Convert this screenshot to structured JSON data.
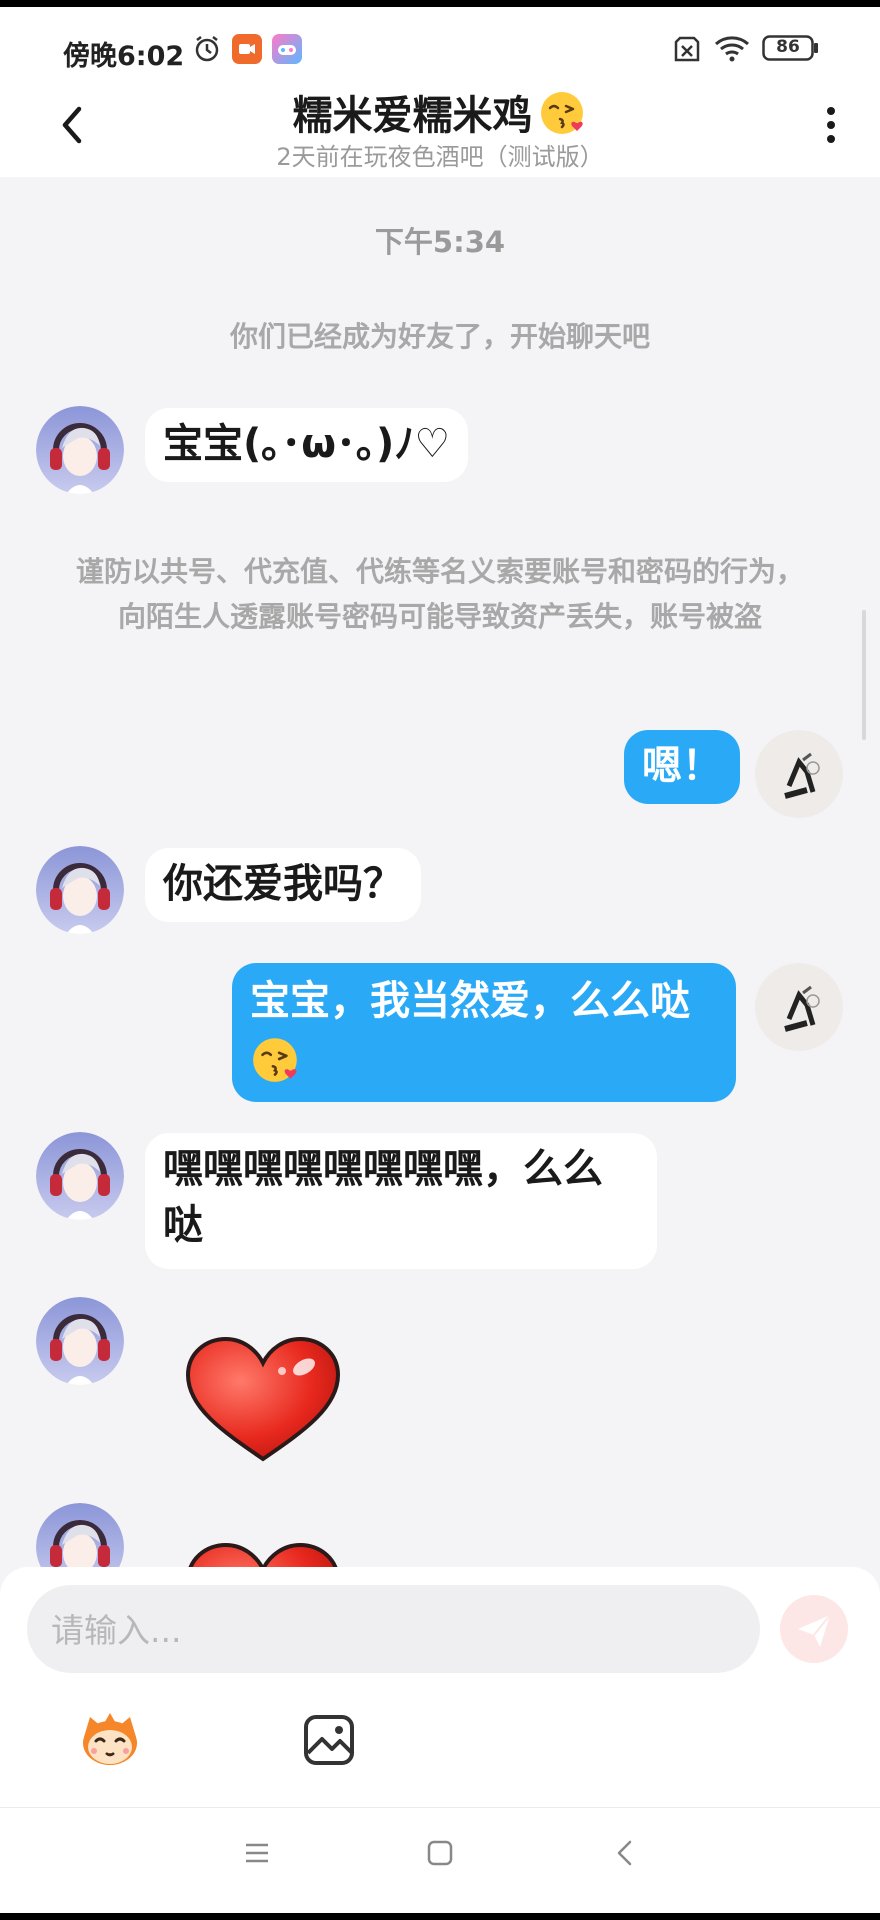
{
  "status_bar": {
    "time": "傍晚6:02",
    "battery": "86"
  },
  "header": {
    "title": "糯米爱糯米鸡",
    "subtitle": "2天前在玩夜色酒吧（测试版）"
  },
  "chat": {
    "timestamp": "下午5:34",
    "friend_notice": "你们已经成为好友了，开始聊天吧",
    "security_warning": "谨防以共号、代充值、代练等名义索要账号和密码的行为，向陌生人透露账号密码可能导致资产丢失，账号被盗",
    "messages": [
      {
        "side": "in",
        "text": "宝宝(｡･ω･｡)ﾉ♡"
      },
      {
        "side": "out",
        "text": "嗯！"
      },
      {
        "side": "in",
        "text": "你还爱我吗？"
      },
      {
        "side": "out",
        "text": "宝宝，我当然爱，么么哒"
      },
      {
        "side": "in",
        "text": "嘿嘿嘿嘿嘿嘿嘿嘿，么么哒"
      }
    ],
    "stickers": [
      "heart-sticker",
      "heart-sticker"
    ]
  },
  "composer": {
    "placeholder": "请输入..."
  },
  "icons": {
    "back": "chevron-left-icon",
    "more": "more-vertical-icon",
    "send": "send-icon",
    "emoji": "emoji-mascot-icon",
    "image": "image-icon"
  },
  "colors": {
    "outgoing_bubble": "#2aaaf6",
    "incoming_bubble": "#ffffff",
    "background": "#f4f4f6",
    "send_button": "#fde6e6"
  }
}
